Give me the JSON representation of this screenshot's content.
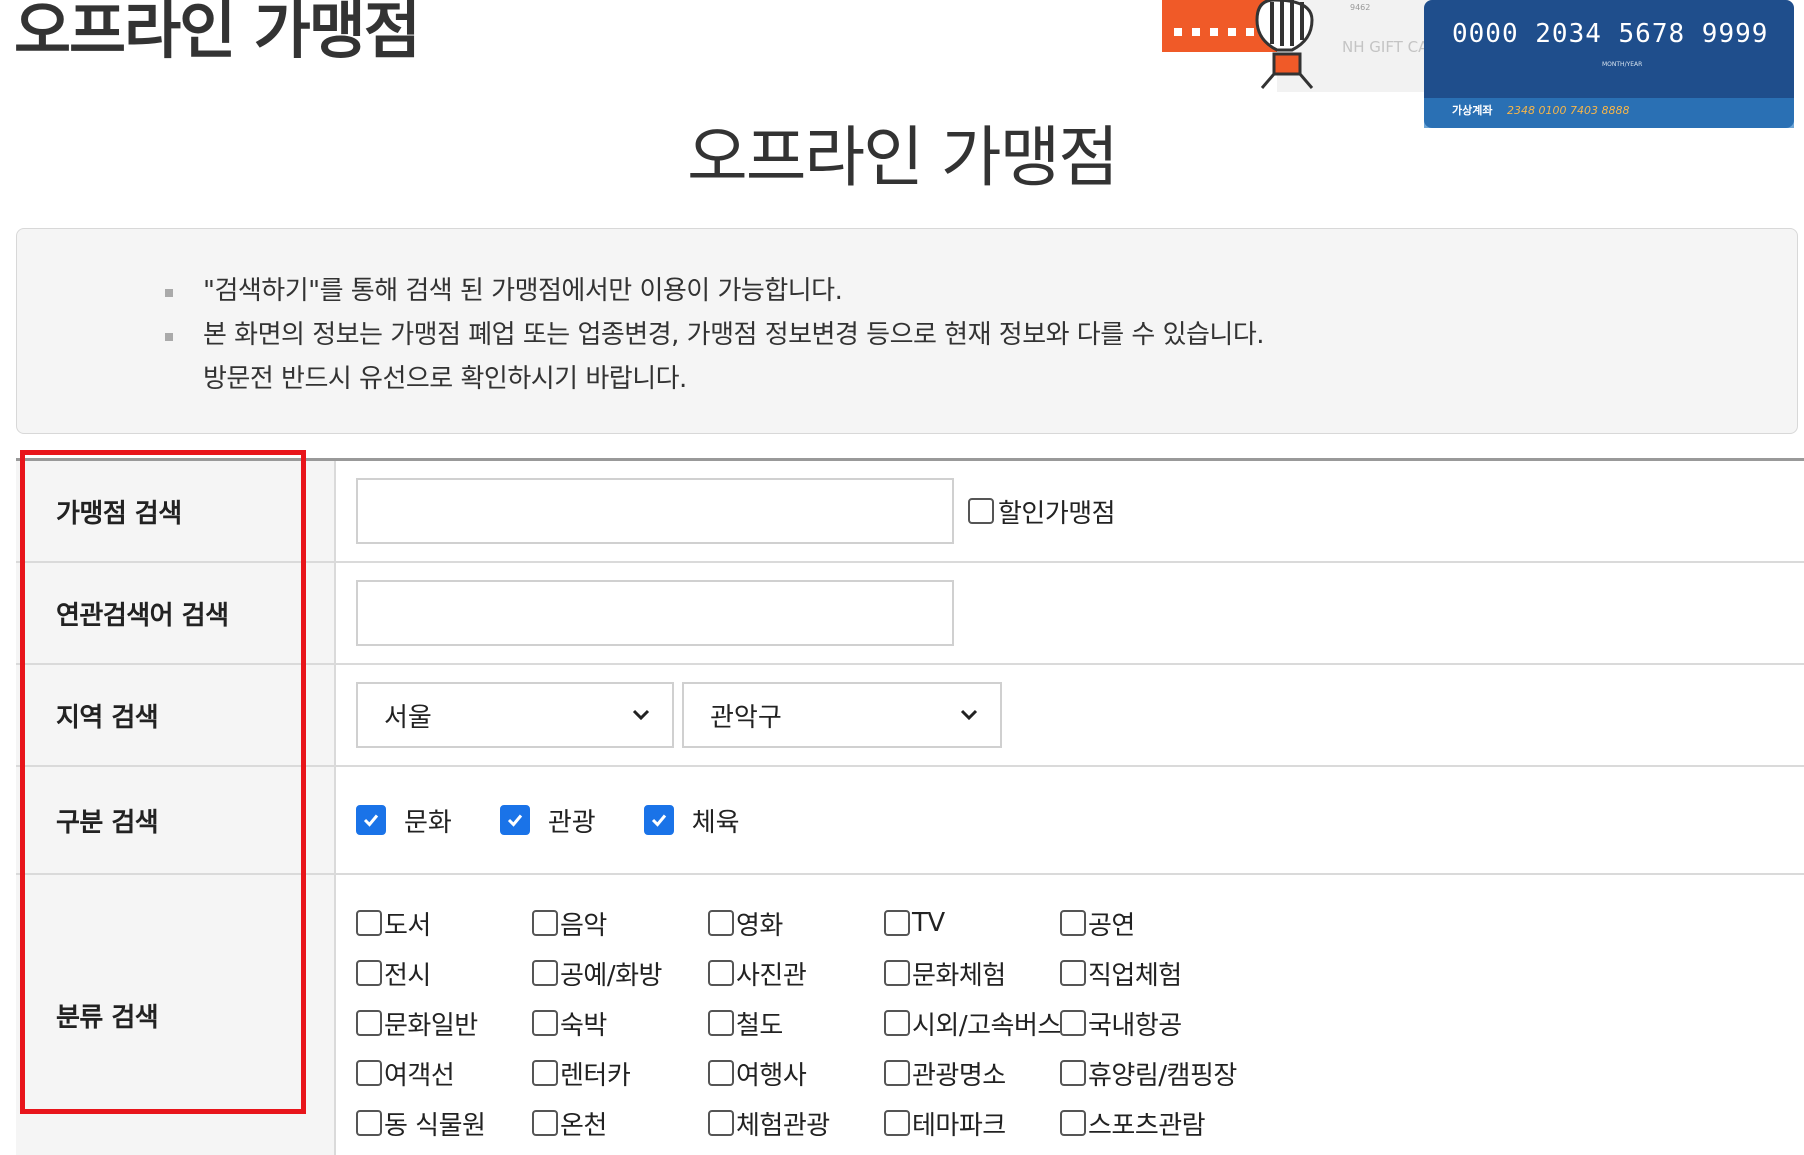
{
  "header": {
    "title": "오프라인 가맹점"
  },
  "banner_card": {
    "number": "0000 2034 5678 9999",
    "gift_text": "NH GIFT CA",
    "account_label": "가상계좌",
    "account_number": "2348 0100 7403 8888",
    "month_year": "MONTH/YEAR",
    "code": "9462",
    "card_color": "#1f4e8c",
    "accent_color": "#f05a28"
  },
  "page": {
    "title": "오프라인 가맹점"
  },
  "notice": {
    "items": [
      "\"검색하기\"를 통해 검색 된 가맹점에서만 이용이 가능합니다.",
      "본 화면의 정보는 가맹점 폐업 또는 업종변경, 가맹점 정보변경 등으로 현재 정보와 다를 수 있습니다."
    ],
    "sub": "방문전 반드시 유선으로 확인하시기 바랍니다."
  },
  "form": {
    "store_search": {
      "label": "가맹점 검색",
      "value": "",
      "discount_label": "할인가맹점",
      "discount_checked": false
    },
    "keyword_search": {
      "label": "연관검색어 검색",
      "value": ""
    },
    "region_search": {
      "label": "지역 검색",
      "city": "서울",
      "district": "관악구"
    },
    "type_search": {
      "label": "구분 검색",
      "options": [
        {
          "label": "문화",
          "checked": true
        },
        {
          "label": "관광",
          "checked": true
        },
        {
          "label": "체육",
          "checked": true
        }
      ]
    },
    "category_search": {
      "label": "분류 검색",
      "options": [
        "도서",
        "음악",
        "영화",
        "TV",
        "공연",
        "전시",
        "공예/화방",
        "사진관",
        "문화체험",
        "직업체험",
        "문화일반",
        "숙박",
        "철도",
        "시외/고속버스",
        "국내항공",
        "여객선",
        "렌터카",
        "여행사",
        "관광명소",
        "휴양림/캠핑장",
        "동 식물원",
        "온천",
        "체험관광",
        "테마파크",
        "스포츠관람"
      ]
    }
  },
  "colors": {
    "highlight": "#e8151b",
    "checkbox": "#1a73e8"
  }
}
